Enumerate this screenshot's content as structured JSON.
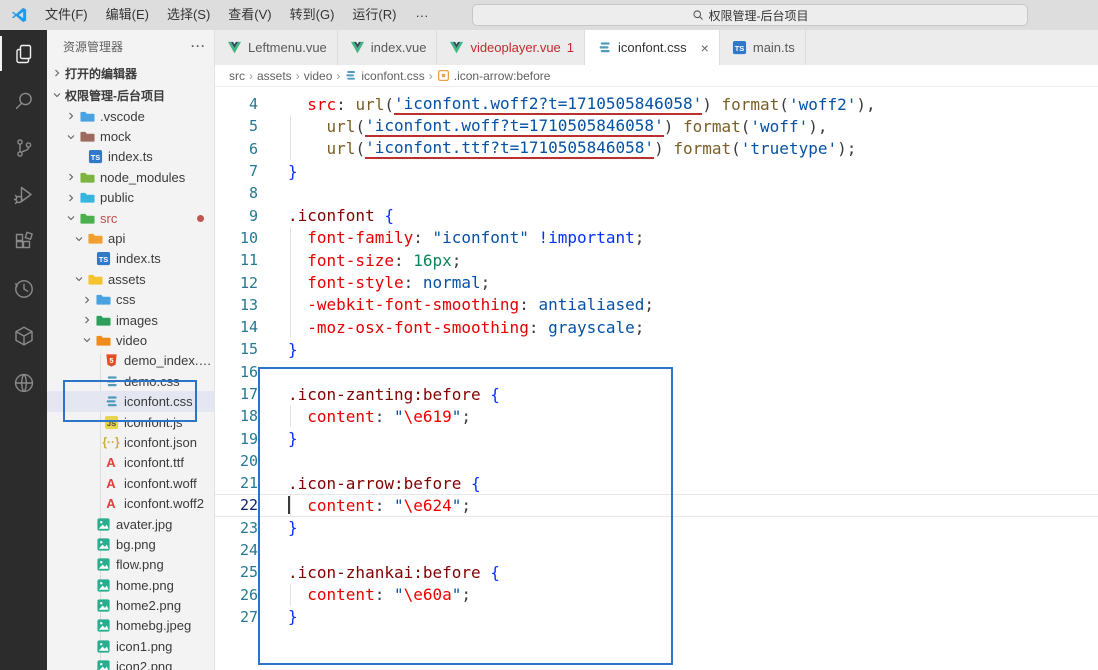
{
  "titlebar": {
    "menus": [
      "文件(F)",
      "编辑(E)",
      "选择(S)",
      "查看(V)",
      "转到(G)",
      "运行(R)"
    ],
    "more": "···",
    "back_arrow": "←",
    "forward_arrow": "→",
    "search_text": "权限管理-后台项目"
  },
  "activitybar": {
    "items": [
      {
        "name": "explorer",
        "active": true
      },
      {
        "name": "search",
        "active": false
      },
      {
        "name": "source-control",
        "active": false
      },
      {
        "name": "run-debug",
        "active": false
      },
      {
        "name": "extensions",
        "active": false
      },
      {
        "name": "history",
        "active": false
      },
      {
        "name": "package",
        "active": false
      },
      {
        "name": "globe",
        "active": false
      }
    ]
  },
  "sidebar": {
    "title": "资源管理器",
    "more": "···",
    "open_editors": "打开的编辑器",
    "project_root": "权限管理-后台项目",
    "tree": [
      {
        "label": ".vscode",
        "type": "folder",
        "level": 1,
        "state": "closed",
        "color": "#4aa3e0"
      },
      {
        "label": "mock",
        "type": "folder",
        "level": 1,
        "state": "open",
        "color": "#9c6b5e"
      },
      {
        "label": "index.ts",
        "type": "ts",
        "level": 2
      },
      {
        "label": "node_modules",
        "type": "folder",
        "level": 1,
        "state": "closed",
        "color": "#7cb342"
      },
      {
        "label": "public",
        "type": "folder",
        "level": 1,
        "state": "closed",
        "color": "#35b5e0"
      },
      {
        "label": "src",
        "type": "folder",
        "level": 1,
        "state": "open",
        "color": "#4caf50",
        "error": true,
        "dot": true
      },
      {
        "label": "api",
        "type": "folder",
        "level": 2,
        "state": "open",
        "color": "#f0a030"
      },
      {
        "label": "index.ts",
        "type": "ts",
        "level": 3
      },
      {
        "label": "assets",
        "type": "folder",
        "level": 2,
        "state": "open",
        "color": "#f4c430"
      },
      {
        "label": "css",
        "type": "folder",
        "level": 3,
        "state": "closed",
        "color": "#4aa3e0"
      },
      {
        "label": "images",
        "type": "folder",
        "level": 3,
        "state": "closed",
        "color": "#2e9e5b"
      },
      {
        "label": "video",
        "type": "folder",
        "level": 3,
        "state": "open",
        "color": "#f08c1e"
      },
      {
        "label": "demo_index.ht...",
        "type": "html",
        "level": 4
      },
      {
        "label": "demo.css",
        "type": "cssfile",
        "level": 4
      },
      {
        "label": "iconfont.css",
        "type": "cssfile",
        "level": 4,
        "selected": true
      },
      {
        "label": "iconfont.js",
        "type": "js",
        "level": 4
      },
      {
        "label": "iconfont.json",
        "type": "json",
        "level": 4
      },
      {
        "label": "iconfont.ttf",
        "type": "font",
        "level": 4
      },
      {
        "label": "iconfont.woff",
        "type": "font",
        "level": 4
      },
      {
        "label": "iconfont.woff2",
        "type": "font",
        "level": 4
      },
      {
        "label": "avater.jpg",
        "type": "image",
        "level": 3
      },
      {
        "label": "bg.png",
        "type": "image",
        "level": 3
      },
      {
        "label": "flow.png",
        "type": "image",
        "level": 3
      },
      {
        "label": "home.png",
        "type": "image",
        "level": 3
      },
      {
        "label": "home2.png",
        "type": "image",
        "level": 3
      },
      {
        "label": "homebg.jpeg",
        "type": "image",
        "level": 3
      },
      {
        "label": "icon1.png",
        "type": "image",
        "level": 3
      },
      {
        "label": "icon2.png",
        "type": "image",
        "level": 3
      }
    ]
  },
  "tabs": [
    {
      "label": "Leftmenu.vue",
      "icon": "vue"
    },
    {
      "label": "index.vue",
      "icon": "vue"
    },
    {
      "label": "videoplayer.vue",
      "icon": "vue",
      "error": true,
      "badge": "1"
    },
    {
      "label": "iconfont.css",
      "icon": "css",
      "active": true,
      "close": "×"
    },
    {
      "label": "main.ts",
      "icon": "ts"
    }
  ],
  "breadcrumb": [
    {
      "label": "src"
    },
    {
      "label": "assets"
    },
    {
      "label": "video"
    },
    {
      "label": "iconfont.css",
      "icon": "css"
    },
    {
      "label": ".icon-arrow:before",
      "icon": "symbol"
    }
  ],
  "code": {
    "lines": [
      {
        "n": 4,
        "t": [
          [
            "pun",
            "  "
          ],
          [
            "prop",
            "src"
          ],
          [
            "pun",
            ": "
          ],
          [
            "fn",
            "url"
          ],
          [
            "pun",
            "("
          ],
          [
            "strr",
            "'iconfont.woff2?t=1710505846058'"
          ],
          [
            "pun",
            ") "
          ],
          [
            "fn",
            "format"
          ],
          [
            "pun",
            "("
          ],
          [
            "str",
            "'woff2'"
          ],
          [
            "pun",
            "),"
          ]
        ]
      },
      {
        "n": 5,
        "g": true,
        "t": [
          [
            "pun",
            "    "
          ],
          [
            "fn",
            "url"
          ],
          [
            "pun",
            "("
          ],
          [
            "strr",
            "'iconfont.woff?t=1710505846058'"
          ],
          [
            "pun",
            ") "
          ],
          [
            "fn",
            "format"
          ],
          [
            "pun",
            "("
          ],
          [
            "str",
            "'woff'"
          ],
          [
            "pun",
            "),"
          ]
        ]
      },
      {
        "n": 6,
        "g": true,
        "t": [
          [
            "pun",
            "    "
          ],
          [
            "fn",
            "url"
          ],
          [
            "pun",
            "("
          ],
          [
            "strr",
            "'iconfont.ttf?t=1710505846058'"
          ],
          [
            "pun",
            ") "
          ],
          [
            "fn",
            "format"
          ],
          [
            "pun",
            "("
          ],
          [
            "str",
            "'truetype'"
          ],
          [
            "pun",
            ");"
          ]
        ]
      },
      {
        "n": 7,
        "t": [
          [
            "brace",
            "}"
          ]
        ]
      },
      {
        "n": 8,
        "t": []
      },
      {
        "n": 9,
        "t": [
          [
            "sel",
            ".iconfont"
          ],
          [
            "pun",
            " "
          ],
          [
            "brace",
            "{"
          ]
        ]
      },
      {
        "n": 10,
        "g": true,
        "t": [
          [
            "pun",
            "  "
          ],
          [
            "prop",
            "font-family"
          ],
          [
            "pun",
            ": "
          ],
          [
            "str",
            "\"iconfont\""
          ],
          [
            "pun",
            " "
          ],
          [
            "imp",
            "!important"
          ],
          [
            "pun",
            ";"
          ]
        ]
      },
      {
        "n": 11,
        "g": true,
        "t": [
          [
            "pun",
            "  "
          ],
          [
            "prop",
            "font-size"
          ],
          [
            "pun",
            ": "
          ],
          [
            "num",
            "16px"
          ],
          [
            "pun",
            ";"
          ]
        ]
      },
      {
        "n": 12,
        "g": true,
        "t": [
          [
            "pun",
            "  "
          ],
          [
            "prop",
            "font-style"
          ],
          [
            "pun",
            ": "
          ],
          [
            "val",
            "normal"
          ],
          [
            "pun",
            ";"
          ]
        ]
      },
      {
        "n": 13,
        "g": true,
        "t": [
          [
            "pun",
            "  "
          ],
          [
            "prop",
            "-webkit-font-smoothing"
          ],
          [
            "pun",
            ": "
          ],
          [
            "val",
            "antialiased"
          ],
          [
            "pun",
            ";"
          ]
        ]
      },
      {
        "n": 14,
        "g": true,
        "t": [
          [
            "pun",
            "  "
          ],
          [
            "prop",
            "-moz-osx-font-smoothing"
          ],
          [
            "pun",
            ": "
          ],
          [
            "val",
            "grayscale"
          ],
          [
            "pun",
            ";"
          ]
        ]
      },
      {
        "n": 15,
        "t": [
          [
            "brace",
            "}"
          ]
        ]
      },
      {
        "n": 16,
        "t": []
      },
      {
        "n": 17,
        "t": [
          [
            "sel",
            ".icon-zanting:before"
          ],
          [
            "pun",
            " "
          ],
          [
            "brace",
            "{"
          ]
        ]
      },
      {
        "n": 18,
        "g": true,
        "t": [
          [
            "pun",
            "  "
          ],
          [
            "prop",
            "content"
          ],
          [
            "pun",
            ": "
          ],
          [
            "str",
            "\""
          ],
          [
            "esc",
            "\\e619"
          ],
          [
            "str",
            "\""
          ],
          [
            "pun",
            ";"
          ]
        ]
      },
      {
        "n": 19,
        "t": [
          [
            "brace",
            "}"
          ]
        ]
      },
      {
        "n": 20,
        "t": []
      },
      {
        "n": 21,
        "t": [
          [
            "sel",
            ".icon-arrow:before"
          ],
          [
            "pun",
            " "
          ],
          [
            "brace",
            "{"
          ]
        ]
      },
      {
        "n": 22,
        "g": true,
        "cur": true,
        "cursor": true,
        "t": [
          [
            "pun",
            "  "
          ],
          [
            "prop",
            "content"
          ],
          [
            "pun",
            ": "
          ],
          [
            "str",
            "\""
          ],
          [
            "esc",
            "\\e624"
          ],
          [
            "str",
            "\""
          ],
          [
            "pun",
            ";"
          ]
        ]
      },
      {
        "n": 23,
        "t": [
          [
            "brace",
            "}"
          ]
        ]
      },
      {
        "n": 24,
        "t": []
      },
      {
        "n": 25,
        "t": [
          [
            "sel",
            ".icon-zhankai:before"
          ],
          [
            "pun",
            " "
          ],
          [
            "brace",
            "{"
          ]
        ]
      },
      {
        "n": 26,
        "g": true,
        "t": [
          [
            "pun",
            "  "
          ],
          [
            "prop",
            "content"
          ],
          [
            "pun",
            ": "
          ],
          [
            "str",
            "\""
          ],
          [
            "esc",
            "\\e60a"
          ],
          [
            "str",
            "\""
          ],
          [
            "pun",
            ";"
          ]
        ]
      },
      {
        "n": 27,
        "t": [
          [
            "brace",
            "}"
          ]
        ]
      }
    ]
  },
  "colors": {
    "annotation": "#2c74c9",
    "error-red": "#bb2f2f",
    "line-number": "#237893",
    "line-number-active": "#0b216f",
    "tk-pun": "#3b3b3b",
    "tk-prop": "#e50000",
    "tk-sel": "#800000",
    "tk-brace": "#0431fa",
    "tk-fn": "#795e26",
    "tk-str": "#0451a5",
    "tk-esc": "#ee0000",
    "tk-num": "#098658",
    "tk-val": "#0451a5",
    "tk-imp": "#0431fa"
  }
}
